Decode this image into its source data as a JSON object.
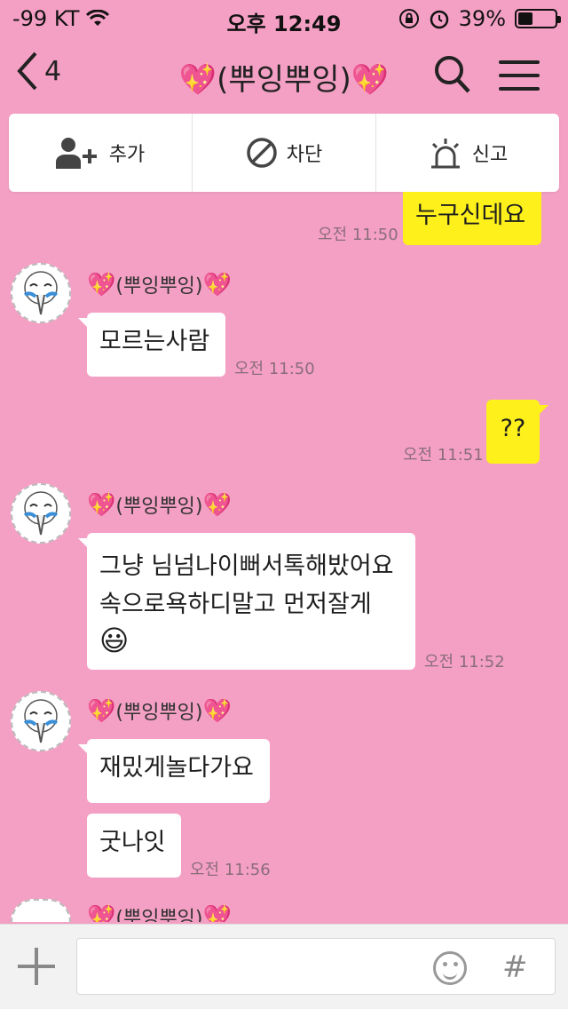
{
  "status_bar": {
    "carrier": "-99 KT",
    "time": "오후 12:49",
    "battery_percent": "39%",
    "battery_level": 0.39,
    "icons": [
      "wifi-icon",
      "orientation-lock-icon",
      "alarm-icon",
      "battery-icon"
    ]
  },
  "header": {
    "back_count": "4",
    "title_text": "(뿌잉뿌잉)",
    "title_decoration": "💖",
    "icons": [
      "chevron-left-icon",
      "search-icon",
      "menu-icon"
    ]
  },
  "action_bar": {
    "add_label": "추가",
    "block_label": "차단",
    "report_label": "신고"
  },
  "messages": {
    "m1": {
      "text": "누구신데요",
      "time": "오전 11:50",
      "from_me": true
    },
    "m2": {
      "sender": "(뿌잉뿌잉)",
      "text": "모르는사람",
      "time": "오전 11:50",
      "from_me": false
    },
    "m3": {
      "text": "??",
      "time": "오전 11:51",
      "from_me": true
    },
    "m4": {
      "sender": "(뿌잉뿌잉)",
      "line1": "그냥 님넘나이뻐서톡해밨어요",
      "line2": "속으로욕하디말고 먼저잘게",
      "emoji": "😃",
      "time": "오전 11:52",
      "from_me": false
    },
    "m5": {
      "sender": "(뿌잉뿌잉)",
      "text": "재밌게놀다가요",
      "from_me": false
    },
    "m6": {
      "text": "굿나잇",
      "time": "오전 11:56",
      "from_me": false
    },
    "m7": {
      "sender": "(뿌잉뿌잉)",
      "from_me": false
    }
  },
  "input_bar": {
    "hash_label": "#",
    "icons": [
      "plus-icon",
      "emoji-icon",
      "hash-icon"
    ]
  },
  "colors": {
    "background": "#f4a0c4",
    "my_bubble": "#fef01b",
    "their_bubble": "#ffffff",
    "heart": "#e0247a"
  }
}
